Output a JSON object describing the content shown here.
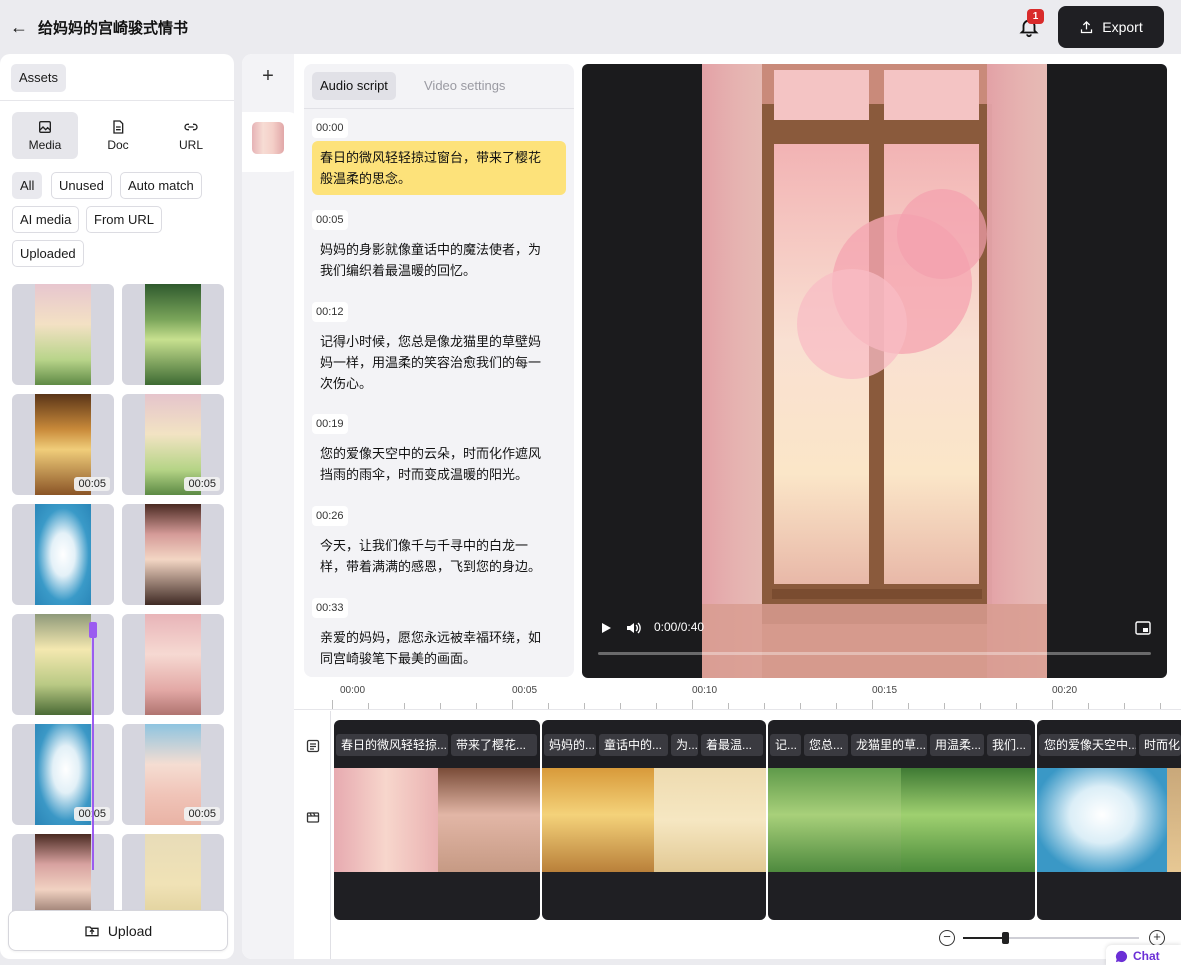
{
  "header": {
    "title": "给妈妈的宫崎骏式情书",
    "notification_count": "1",
    "export_label": "Export"
  },
  "assets": {
    "tab_label": "Assets",
    "type_tabs": [
      {
        "label": "Media",
        "icon": "image-icon"
      },
      {
        "label": "Doc",
        "icon": "document-icon"
      },
      {
        "label": "URL",
        "icon": "link-icon"
      }
    ],
    "filters": [
      "All",
      "Unused",
      "Auto match",
      "AI media",
      "From URL",
      "Uploaded"
    ],
    "thumbnails": [
      {
        "duration": ""
      },
      {
        "duration": ""
      },
      {
        "duration": "00:05"
      },
      {
        "duration": "00:05"
      },
      {
        "duration": ""
      },
      {
        "duration": ""
      },
      {
        "duration": ""
      },
      {
        "duration": ""
      },
      {
        "duration": "00:05"
      },
      {
        "duration": "00:05"
      },
      {
        "duration": ""
      },
      {
        "duration": ""
      }
    ],
    "upload_label": "Upload"
  },
  "script": {
    "tabs": [
      "Audio script",
      "Video settings"
    ],
    "segments": [
      {
        "time": "00:00",
        "line1": "春日的微风轻轻掠过窗台，带来了樱花",
        "line2": "般温柔的思念。",
        "line3": ""
      },
      {
        "time": "00:05",
        "line1": "妈妈的身影就像童话中的魔法使者，为",
        "line2": "我们编织着最温暖的回忆。",
        "line3": ""
      },
      {
        "time": "00:12",
        "line1": "记得小时候，您总是像龙猫里的草壁妈",
        "line2": "妈一样，用温柔的笑容治愈我们的每一",
        "line3": "次伤心。"
      },
      {
        "time": "00:19",
        "line1": "您的爱像天空中的云朵，时而化作遮风",
        "line2": "挡雨的雨伞，时而变成温暖的阳光。",
        "line3": ""
      },
      {
        "time": "00:26",
        "line1": "今天，让我们像千与千寻中的白龙一",
        "line2": "样，带着满满的感恩，飞到您的身边。",
        "line3": ""
      },
      {
        "time": "00:33",
        "line1": "亲爱的妈妈，愿您永远被幸福环绕，如",
        "line2": "同宫崎骏笔下最美的画面。",
        "line3": ""
      }
    ]
  },
  "video": {
    "time": "0:00/0:40"
  },
  "timeline": {
    "ticks": [
      "00:00",
      "00:05",
      "00:10",
      "00:15",
      "00:20"
    ],
    "clips": [
      {
        "captions": [
          "春日的微风轻轻掠...",
          "带来了樱花..."
        ]
      },
      {
        "captions": [
          "妈妈的...",
          "童话中的...",
          "为...",
          "着最温..."
        ]
      },
      {
        "captions": [
          "记...",
          "您总...",
          "龙猫里的草...",
          "用温柔...",
          "我们..."
        ]
      },
      {
        "captions": [
          "您的爱像天空中...",
          "时而化"
        ]
      }
    ]
  },
  "zoom": {
    "level": 0.24
  },
  "chat": {
    "label": "Chat"
  },
  "colors": {
    "accent": "#9b5cf0",
    "highlight": "#fde27a",
    "export_bg": "#1f1f23",
    "badge": "#d92b2b"
  }
}
